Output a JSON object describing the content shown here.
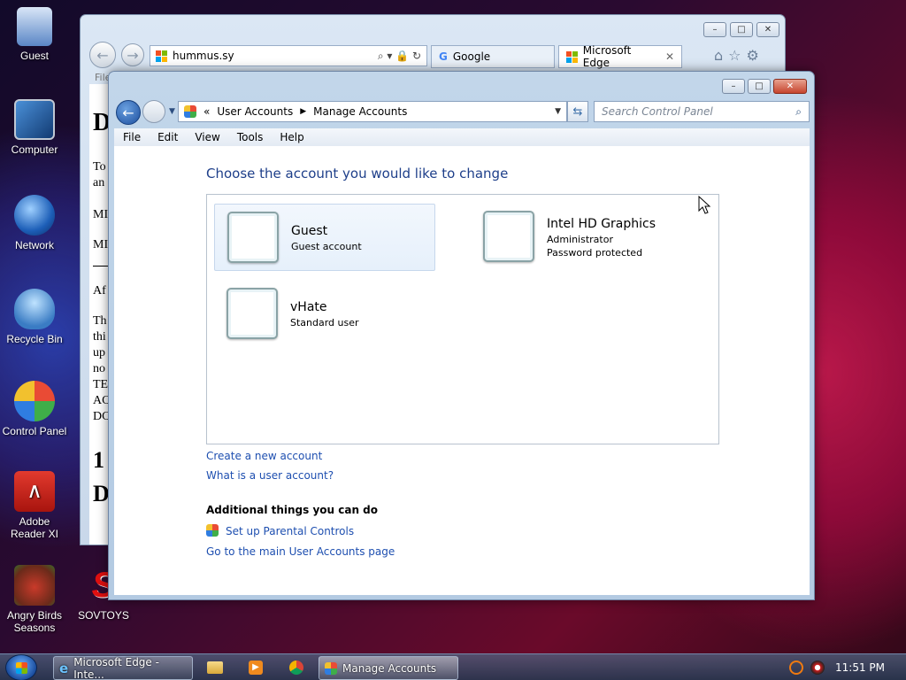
{
  "desktop": {
    "icons": [
      {
        "label": "Guest"
      },
      {
        "label": "Computer"
      },
      {
        "label": "Network"
      },
      {
        "label": "Recycle Bin"
      },
      {
        "label": "Control Panel"
      },
      {
        "label": "Adobe Reader XI"
      },
      {
        "label": "Angry Birds Seasons"
      },
      {
        "label": "SOVTOYS"
      }
    ]
  },
  "browser": {
    "address": "hummus.sy",
    "tabs": [
      {
        "label": "Google"
      },
      {
        "label": "Microsoft Edge"
      }
    ],
    "menu_partial": "File",
    "doc_fragments": [
      "D",
      "To",
      "an",
      "MI",
      "MI",
      "Af",
      "Th",
      "thi",
      "up",
      "no",
      "TE",
      "AC",
      "DC",
      "1",
      "D"
    ]
  },
  "control_panel": {
    "breadcrumb": [
      "User Accounts",
      "Manage Accounts"
    ],
    "breadcrumb_prefix": "«",
    "search_placeholder": "Search Control Panel",
    "menu": [
      "File",
      "Edit",
      "View",
      "Tools",
      "Help"
    ],
    "title": "Choose the account you would like to change",
    "accounts": [
      {
        "name": "Guest",
        "details": [
          "Guest account"
        ]
      },
      {
        "name": "Intel HD Graphics",
        "details": [
          "Administrator",
          "Password protected"
        ]
      },
      {
        "name": "vHate",
        "details": [
          "Standard user"
        ]
      }
    ],
    "links": {
      "create": "Create a new account",
      "what_is": "What is a user account?"
    },
    "additional_heading": "Additional things you can do",
    "additional_links": {
      "parental": "Set up Parental Controls",
      "main_page": "Go to the main User Accounts page"
    }
  },
  "taskbar": {
    "buttons": [
      {
        "label": "Microsoft Edge - Inte..."
      },
      {
        "label": "Manage Accounts"
      }
    ],
    "clock": "11:51 PM"
  },
  "colors": {
    "link": "#1e4fb0",
    "title": "#1e3f8a"
  }
}
